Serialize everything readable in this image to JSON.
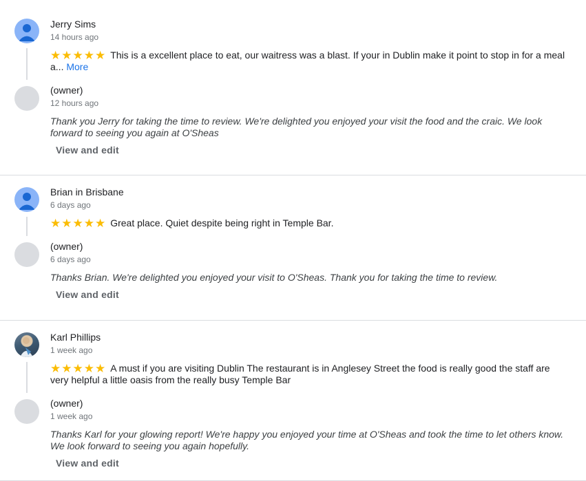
{
  "reviews": [
    {
      "author": "Jerry Sims",
      "time": "14 hours ago",
      "stars": "★★★★★",
      "text": "This is a excellent place to eat, our waitress was a blast. If your in Dublin make it point to stop in for a meal a...",
      "more_label": "More",
      "owner_label": "(owner)",
      "owner_time": "12 hours ago",
      "reply": "Thank you Jerry for taking the time to review. We're delighted you enjoyed your visit the food and the craic. We look forward to seeing you again at O'Sheas",
      "edit_label": "View and edit"
    },
    {
      "author": "Brian in Brisbane",
      "time": "6 days ago",
      "stars": "★★★★★",
      "text": "Great place. Quiet despite being right in Temple Bar.",
      "owner_label": "(owner)",
      "owner_time": "6 days ago",
      "reply": "Thanks Brian. We're delighted you enjoyed your visit to O'Sheas. Thank you for taking the time to review.",
      "edit_label": "View and edit"
    },
    {
      "author": "Karl Phillips",
      "time": "1 week ago",
      "stars": "★★★★★",
      "text": "A must if you are visiting Dublin The restaurant is in Anglesey Street the food is really good the staff are very helpful a little oasis from the really busy Temple Bar",
      "owner_label": "(owner)",
      "owner_time": "1 week ago",
      "reply": "Thanks Karl for your glowing report! We're happy you enjoyed your time at O'Sheas and took the time to let others know. We look forward to seeing you again hopefully.",
      "edit_label": "View and edit"
    }
  ],
  "colors": {
    "star": "#fbbc04",
    "link": "#1a73e8",
    "avatar_generic": "#8ab4f8",
    "avatar_owner": "#dadce0"
  }
}
